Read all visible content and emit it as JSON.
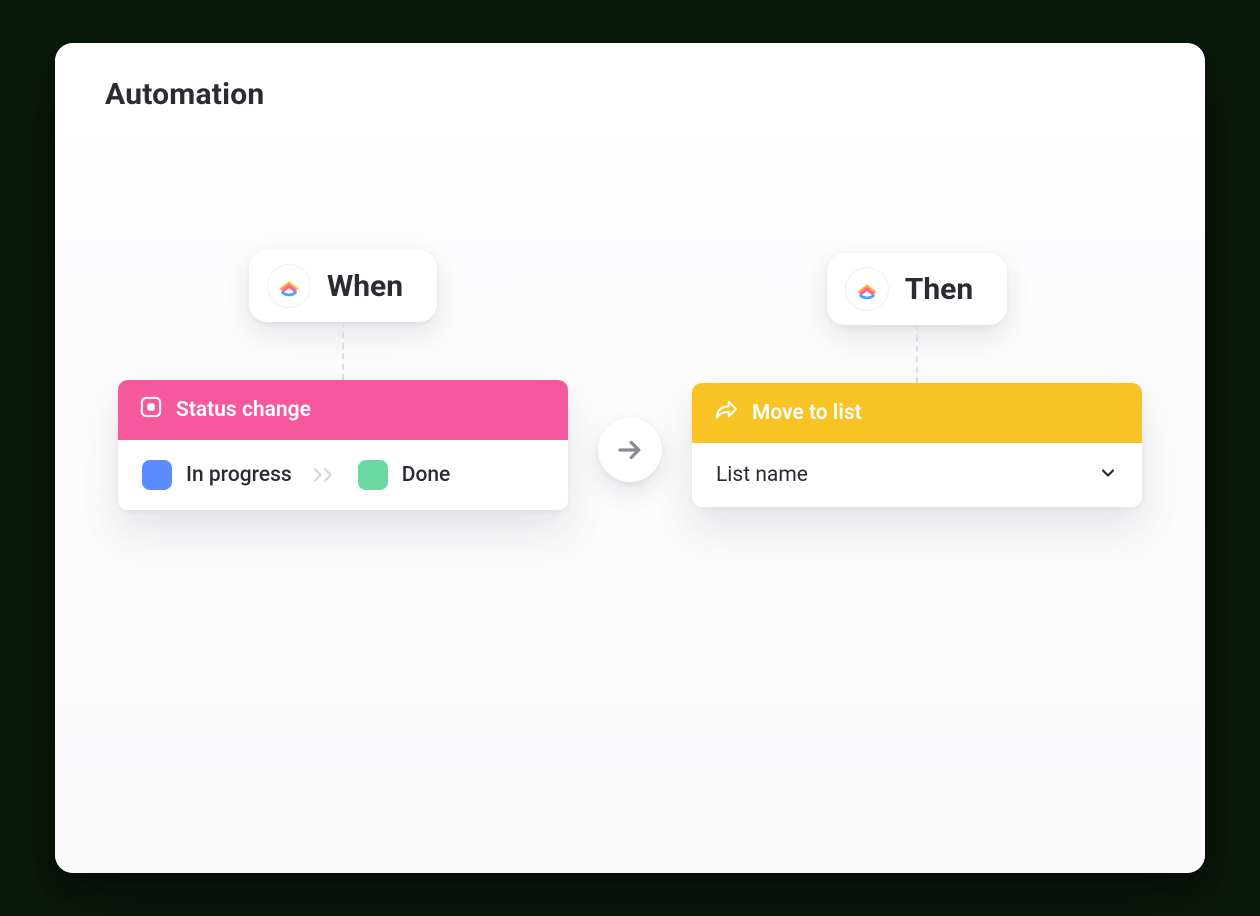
{
  "header": {
    "title": "Automation"
  },
  "when": {
    "chip_label": "When",
    "trigger": {
      "title": "Status change",
      "from": "In progress",
      "to": "Done"
    }
  },
  "then": {
    "chip_label": "Then",
    "action": {
      "title": "Move to list",
      "list_placeholder": "List name"
    }
  },
  "colors": {
    "pink": "#f5589c",
    "amber": "#f7c325",
    "blue": "#5a8cff",
    "green": "#6ad9a4"
  }
}
